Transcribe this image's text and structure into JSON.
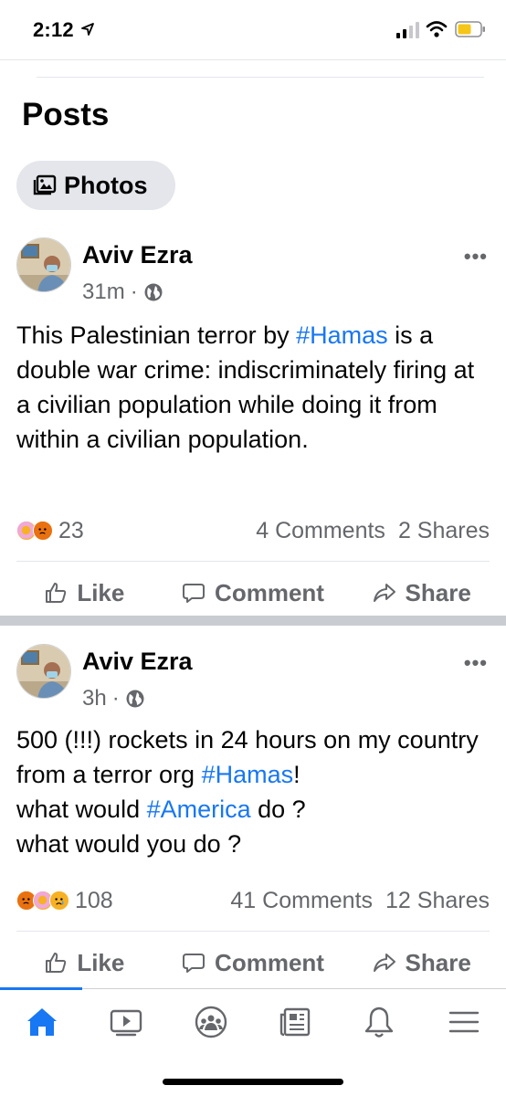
{
  "status_bar": {
    "time": "2:12",
    "battery_color": "#f5c518"
  },
  "section": {
    "title": "Posts",
    "photos_label": "Photos"
  },
  "posts": [
    {
      "author": "Aviv Ezra",
      "time": "31m",
      "text_parts": [
        "This Palestinian terror by ",
        "#Hamas",
        " is a double war crime: indiscriminately firing at a civilian population while doing it from within a civilian population."
      ],
      "reactions": [
        "care-icon",
        "angry-icon"
      ],
      "reaction_count": "23",
      "comments": "4 Comments",
      "shares": "2 Shares"
    },
    {
      "author": "Aviv Ezra",
      "time": "3h",
      "text_line1_a": "500 (!!!) rockets in 24 hours on my country from a terror org ",
      "text_line1_tag": "#Hamas",
      "text_line1_b": "!",
      "text_line2_a": "what would ",
      "text_line2_tag": "#America",
      "text_line2_b": " do ?",
      "text_line3": "what would you do ?",
      "reactions": [
        "angry-icon",
        "care-icon",
        "sad-icon"
      ],
      "reaction_count": "108",
      "comments": "41 Comments",
      "shares": "12 Shares"
    }
  ],
  "actions": {
    "like": "Like",
    "comment": "Comment",
    "share": "Share"
  },
  "tab_bar": {
    "active_color": "#1877f2",
    "tabs": [
      "home-icon",
      "watch-icon",
      "groups-icon",
      "news-icon",
      "notifications-icon",
      "menu-icon"
    ]
  },
  "colors": {
    "link": "#1877f2",
    "muted": "#65676b"
  }
}
